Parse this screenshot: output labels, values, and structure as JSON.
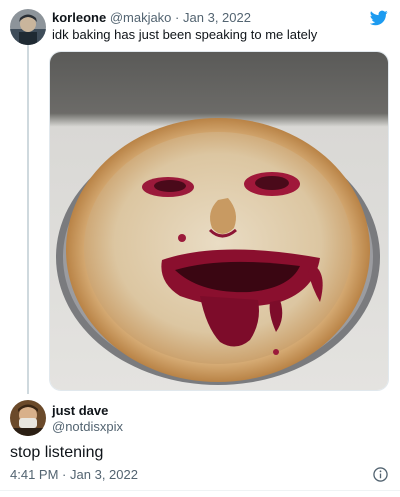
{
  "quoted_tweet": {
    "display_name": "korleone",
    "handle": "@makjako",
    "separator": "·",
    "date": "Jan 3, 2022",
    "text": "idk baking has just been speaking to me lately",
    "avatar_icon": "profile-photo-icon",
    "brand_icon": "twitter-bird-icon",
    "brand_color": "#1d9bf0",
    "media_description_icon": "pie-face-photo"
  },
  "reply_tweet": {
    "display_name": "just dave",
    "handle": "@notdisxpix",
    "text": "stop listening",
    "time": "4:41 PM",
    "separator": "·",
    "date": "Jan 3, 2022",
    "avatar_icon": "profile-photo-icon",
    "info_icon": "info-icon"
  }
}
